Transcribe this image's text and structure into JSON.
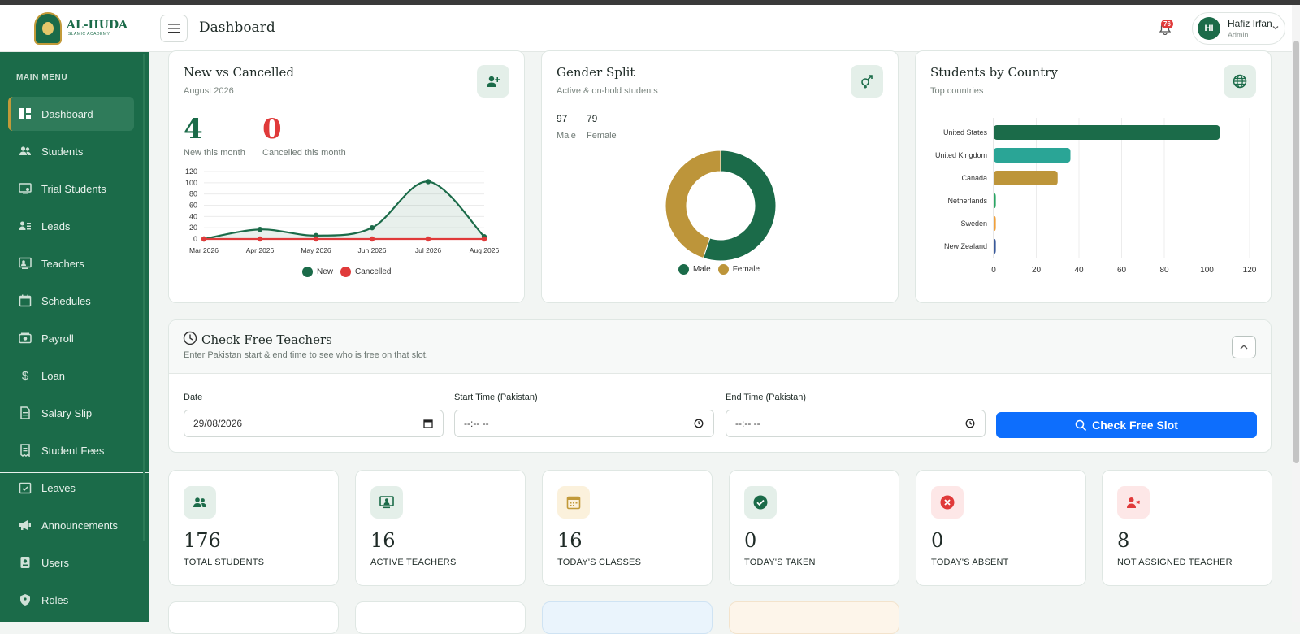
{
  "app": {
    "logo_name": "AL-HUDA",
    "logo_sub": "ISLAMIC ACADEMY",
    "page_title": "Dashboard"
  },
  "sidebar": {
    "section_title": "MAIN MENU",
    "items": [
      {
        "label": "Dashboard",
        "icon": "dashboard-icon"
      },
      {
        "label": "Students",
        "icon": "users-icon"
      },
      {
        "label": "Trial Students",
        "icon": "monitor-user-icon"
      },
      {
        "label": "Leads",
        "icon": "address-card-icon"
      },
      {
        "label": "Teachers",
        "icon": "chalkboard-teacher-icon"
      },
      {
        "label": "Schedules",
        "icon": "calendar-icon"
      },
      {
        "label": "Payroll",
        "icon": "money-icon"
      },
      {
        "label": "Loan",
        "icon": "dollar-icon"
      },
      {
        "label": "Salary Slip",
        "icon": "file-icon"
      },
      {
        "label": "Student Fees",
        "icon": "receipt-icon"
      },
      {
        "label": "Leaves",
        "icon": "calendar-check-icon"
      },
      {
        "label": "Announcements",
        "icon": "megaphone-icon"
      },
      {
        "label": "Users",
        "icon": "id-badge-icon"
      },
      {
        "label": "Roles",
        "icon": "shield-icon"
      }
    ]
  },
  "topbar": {
    "notification_count": "76",
    "user_initials": "HI",
    "user_name": "Hafiz Irfan",
    "user_role": "Admin"
  },
  "new_vs_cancelled": {
    "title": "New vs Cancelled",
    "subtitle": "August 2026",
    "new_value": "4",
    "new_caption": "New this month",
    "cancelled_value": "0",
    "cancelled_caption": "Cancelled this month"
  },
  "gender_split": {
    "title": "Gender Split",
    "subtitle": "Active & on-hold students",
    "male_count": "97",
    "male_label": "Male",
    "female_count": "79",
    "female_label": "Female"
  },
  "students_by_country": {
    "title": "Students by Country",
    "subtitle": "Top countries"
  },
  "chart_data": [
    {
      "type": "line",
      "x": [
        "Mar 2026",
        "Apr 2026",
        "May 2026",
        "Jun 2026",
        "Jul 2026",
        "Aug 2026"
      ],
      "series": [
        {
          "name": "New",
          "values": [
            0,
            17,
            6,
            20,
            102,
            4
          ],
          "color": "#1b6b49"
        },
        {
          "name": "Cancelled",
          "values": [
            0,
            0,
            0,
            0,
            0,
            0
          ],
          "color": "#e03a3a"
        }
      ],
      "ylim": [
        0,
        120
      ],
      "yticks": [
        "120",
        "100",
        "80",
        "60",
        "40",
        "20",
        "0"
      ],
      "grid": true,
      "legend": "bottom"
    },
    {
      "type": "pie",
      "categories": [
        "Male",
        "Female"
      ],
      "values": [
        97,
        79
      ],
      "colors": [
        "#1b6b49",
        "#bd953a"
      ],
      "legend": "bottom"
    },
    {
      "type": "bar",
      "orientation": "horizontal",
      "categories": [
        "United States",
        "United Kingdom",
        "Canada",
        "Netherlands",
        "Sweden",
        "New Zealand"
      ],
      "values": [
        106,
        36,
        30,
        1,
        1,
        1
      ],
      "colors": [
        "#1b6b49",
        "#2aa596",
        "#bd953a",
        "#2aa563",
        "#f0a03c",
        "#3a5a9a"
      ],
      "xlim": [
        0,
        120
      ],
      "xticks": [
        "0",
        "20",
        "40",
        "60",
        "80",
        "100",
        "120"
      ],
      "grid": true
    }
  ],
  "check_free_teachers": {
    "title": "Check Free Teachers",
    "subtitle": "Enter Pakistan start & end time to see who is free on that slot.",
    "date_label": "Date",
    "date_value": "29/08/2026",
    "start_label": "Start Time (Pakistan)",
    "start_value": "--:-- --",
    "end_label": "End Time (Pakistan)",
    "end_value": "--:-- --",
    "button_label": "Check Free Slot"
  },
  "stats": [
    {
      "value": "176",
      "label": "TOTAL STUDENTS",
      "icon": "users-icon",
      "bg": "#e4efe9",
      "fg": "#1b6b49"
    },
    {
      "value": "16",
      "label": "ACTIVE TEACHERS",
      "icon": "chalkboard-teacher-icon",
      "bg": "#e4efe9",
      "fg": "#1b6b49"
    },
    {
      "value": "16",
      "label": "TODAY'S CLASSES",
      "icon": "calendar-icon",
      "bg": "#fbf1dc",
      "fg": "#c29a39"
    },
    {
      "value": "0",
      "label": "TODAY'S TAKEN",
      "icon": "check-circle-icon",
      "bg": "#e4efe9",
      "fg": "#1b6b49"
    },
    {
      "value": "0",
      "label": "TODAY'S ABSENT",
      "icon": "x-circle-icon",
      "bg": "#fde7e7",
      "fg": "#e03a3a"
    },
    {
      "value": "8",
      "label": "NOT ASSIGNED TEACHER",
      "icon": "user-x-icon",
      "bg": "#fde7e7",
      "fg": "#e03a3a"
    }
  ]
}
